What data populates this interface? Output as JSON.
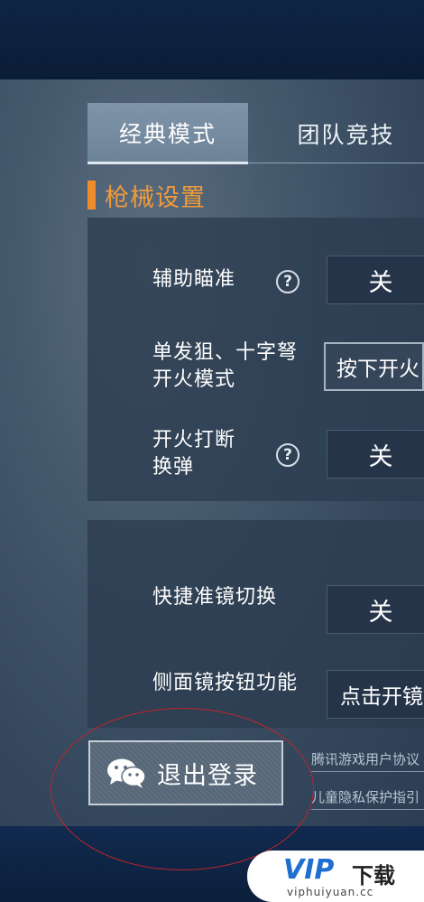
{
  "tabs": [
    {
      "label": "经典模式",
      "active": true
    },
    {
      "label": "团队竞技",
      "active": false
    }
  ],
  "section": {
    "title": "枪械设置",
    "accent": "#f08d2a"
  },
  "group1": {
    "rows": [
      {
        "label": "辅助瞄准",
        "value": "关",
        "has_help": true
      },
      {
        "label_line1": "单发狙、十字弩",
        "label_line2": "开火模式",
        "value": "按下开火"
      },
      {
        "label_line1": "开火打断",
        "label_line2": "换弹",
        "value": "关",
        "has_help": true
      }
    ]
  },
  "group2": {
    "rows": [
      {
        "label": "快捷准镜切换",
        "value": "关"
      },
      {
        "label": "侧面镜按钮功能",
        "value": "点击开镜"
      }
    ]
  },
  "logout": {
    "label": "退出登录",
    "icon": "wechat-icon"
  },
  "links": {
    "user_agreement": "腾讯游戏用户协议",
    "child_privacy": "儿童隐私保护指引"
  },
  "watermark": {
    "logo": "VIP",
    "text": "下载",
    "url": "viphuiyuan.cc"
  },
  "colors": {
    "accent_orange": "#f08d2a",
    "highlight_circle": "#c0242b"
  }
}
